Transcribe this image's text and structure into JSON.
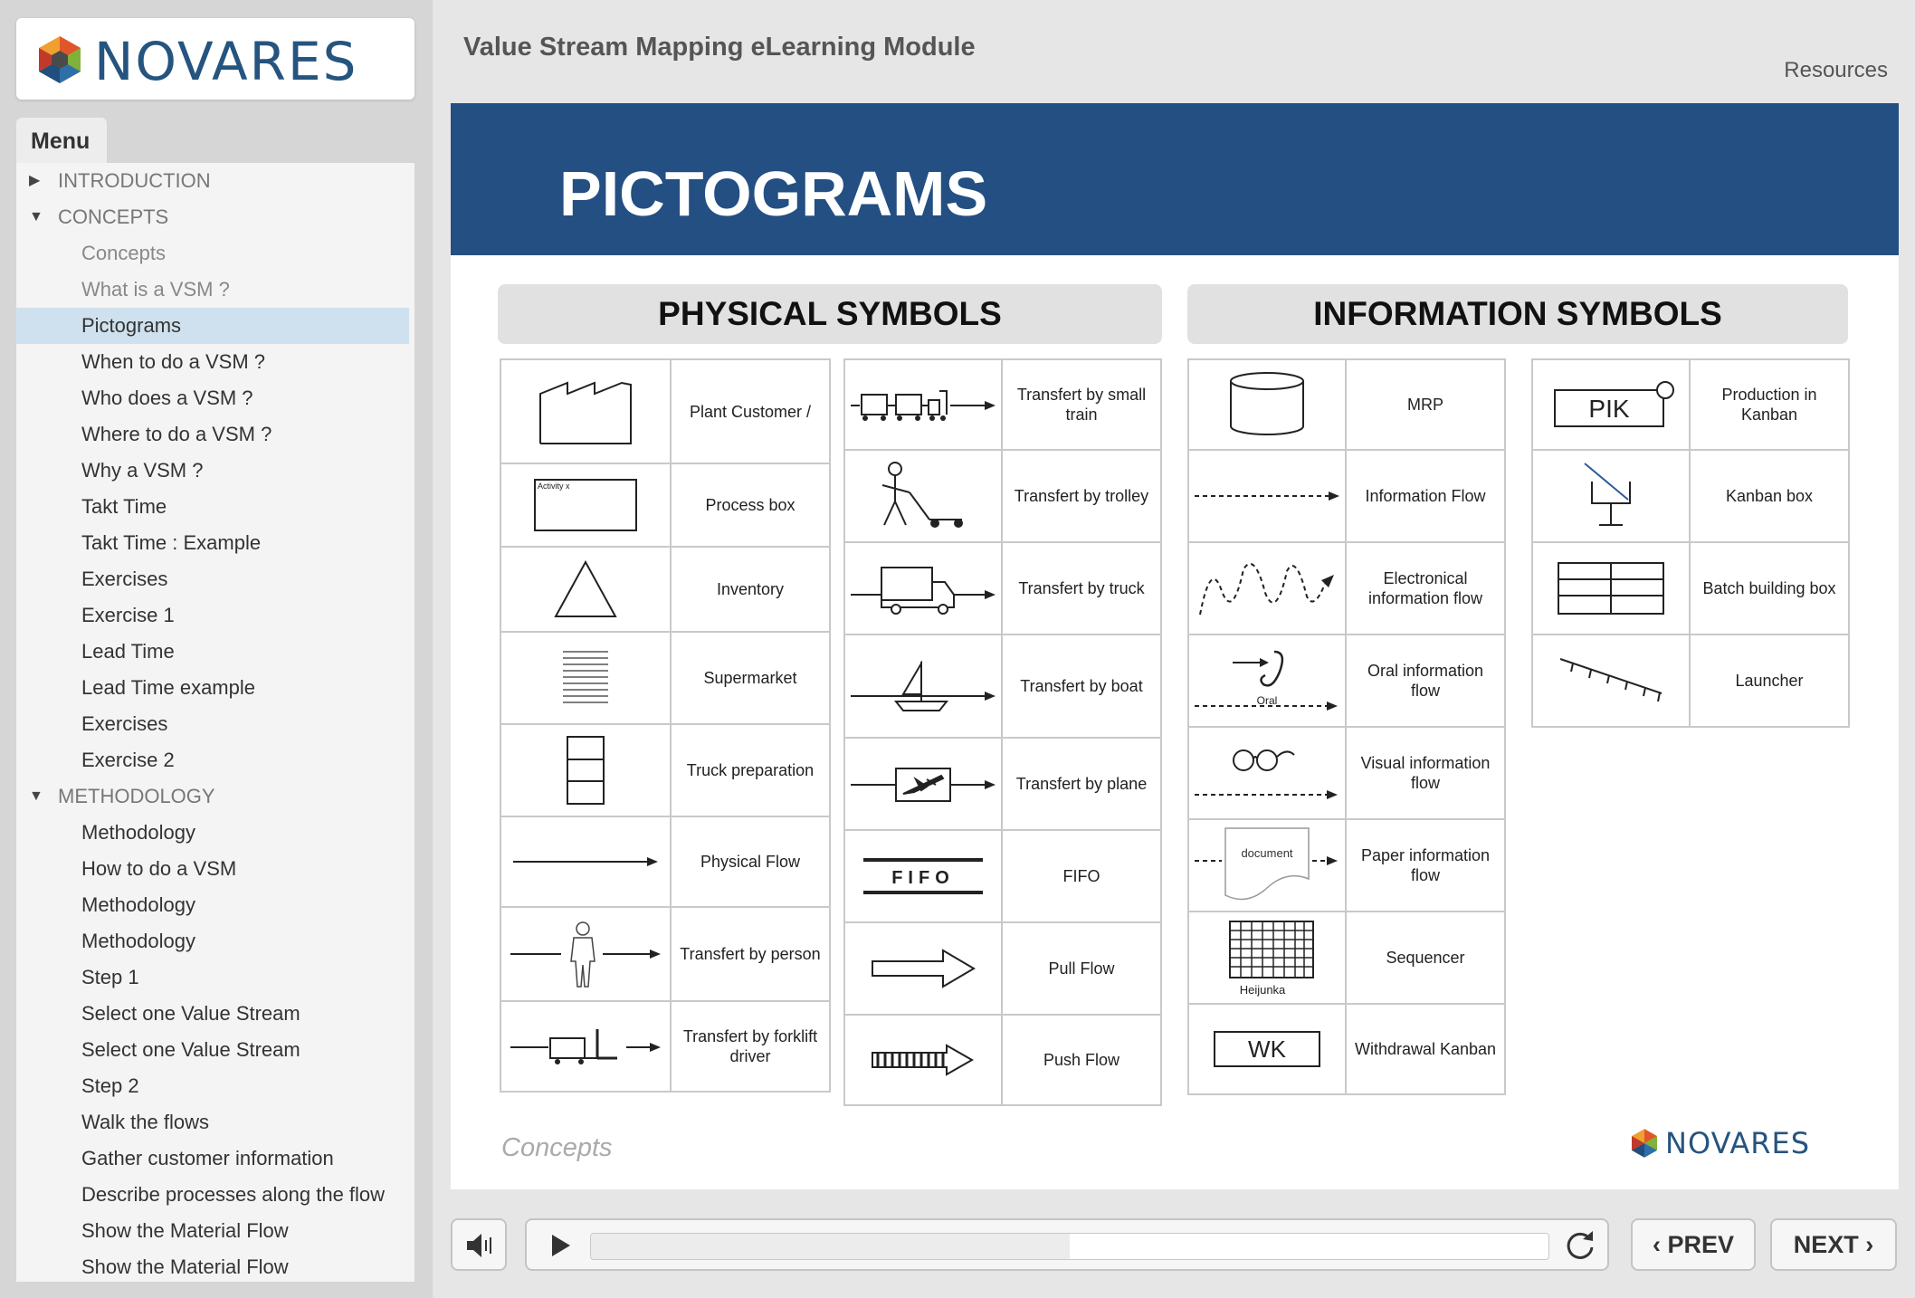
{
  "app": {
    "brand": "NOVARES",
    "module_title": "Value Stream Mapping eLearning Module",
    "resources_label": "Resources"
  },
  "menu": {
    "tab_label": "Menu",
    "rows": [
      {
        "type": "section",
        "label": "INTRODUCTION",
        "expanded": false
      },
      {
        "type": "section",
        "label": "CONCEPTS",
        "expanded": true
      },
      {
        "type": "item",
        "label": "Concepts",
        "visited": true
      },
      {
        "type": "item",
        "label": "What is a VSM ?",
        "visited": true
      },
      {
        "type": "item",
        "label": "Pictograms",
        "active": true
      },
      {
        "type": "item",
        "label": "When to do a VSM ?"
      },
      {
        "type": "item",
        "label": "Who does a VSM ?"
      },
      {
        "type": "item",
        "label": "Where to do a VSM ?"
      },
      {
        "type": "item",
        "label": "Why a VSM ?"
      },
      {
        "type": "item",
        "label": "Takt Time"
      },
      {
        "type": "item",
        "label": "Takt Time : Example"
      },
      {
        "type": "item",
        "label": "Exercises"
      },
      {
        "type": "item",
        "label": "Exercise 1"
      },
      {
        "type": "item",
        "label": "Lead Time"
      },
      {
        "type": "item",
        "label": "Lead Time example"
      },
      {
        "type": "item",
        "label": "Exercises"
      },
      {
        "type": "item",
        "label": "Exercise 2"
      },
      {
        "type": "section",
        "label": "METHODOLOGY",
        "expanded": true
      },
      {
        "type": "item",
        "label": "Methodology"
      },
      {
        "type": "item",
        "label": "How to do a VSM"
      },
      {
        "type": "item",
        "label": "Methodology"
      },
      {
        "type": "item",
        "label": "Methodology"
      },
      {
        "type": "item",
        "label": "Step 1"
      },
      {
        "type": "item",
        "label": "Select one Value Stream"
      },
      {
        "type": "item",
        "label": "Select one Value Stream"
      },
      {
        "type": "item",
        "label": "Step 2"
      },
      {
        "type": "item",
        "label": "Walk the flows"
      },
      {
        "type": "item",
        "label": "Gather customer information"
      },
      {
        "type": "item",
        "label": "Describe processes along the flow"
      },
      {
        "type": "item",
        "label": "Show the Material Flow"
      },
      {
        "type": "item",
        "label": "Show the Material Flow"
      }
    ]
  },
  "slide": {
    "title": "PICTOGRAMS",
    "footer_label": "Concepts",
    "physical": {
      "header": "PHYSICAL SYMBOLS",
      "col1": [
        {
          "label": "Plant Customer /",
          "icon": "factory-icon"
        },
        {
          "label": "Process box",
          "icon": "process-box-icon",
          "icon_text": "Activity x"
        },
        {
          "label": "Inventory",
          "icon": "inventory-triangle-icon"
        },
        {
          "label": "Supermarket",
          "icon": "supermarket-icon"
        },
        {
          "label": "Truck preparation",
          "icon": "truck-preparation-icon"
        },
        {
          "label": "Physical Flow",
          "icon": "physical-flow-arrow-icon"
        },
        {
          "label": "Transfert by person",
          "icon": "person-transfer-icon"
        },
        {
          "label": "Transfert by forklift driver",
          "icon": "forklift-icon"
        }
      ],
      "col2": [
        {
          "label": "Transfert by small train",
          "icon": "small-train-icon"
        },
        {
          "label": "Transfert by trolley",
          "icon": "trolley-icon"
        },
        {
          "label": "Transfert by truck",
          "icon": "truck-icon"
        },
        {
          "label": "Transfert by boat",
          "icon": "boat-icon"
        },
        {
          "label": "Transfert by plane",
          "icon": "plane-icon"
        },
        {
          "label": "FIFO",
          "icon": "fifo-icon",
          "icon_text": "FIFO"
        },
        {
          "label": "Pull Flow",
          "icon": "pull-flow-arrow-icon"
        },
        {
          "label": "Push Flow",
          "icon": "push-flow-arrow-icon"
        }
      ]
    },
    "information": {
      "header": "INFORMATION SYMBOLS",
      "col1": [
        {
          "label": "MRP",
          "icon": "mrp-cylinder-icon"
        },
        {
          "label": "Information Flow",
          "icon": "information-flow-arrow-icon"
        },
        {
          "label": "Electronical information flow",
          "icon": "electronic-flow-icon"
        },
        {
          "label": "Oral information flow",
          "icon": "oral-flow-icon",
          "icon_text": "Oral"
        },
        {
          "label": "Visual information flow",
          "icon": "visual-flow-icon"
        },
        {
          "label": "Paper information flow",
          "icon": "paper-flow-icon",
          "icon_text": "document"
        },
        {
          "label": "Sequencer",
          "icon": "heijunka-icon",
          "icon_text": "Heijunka"
        },
        {
          "label": "Withdrawal Kanban",
          "icon": "withdrawal-kanban-icon",
          "icon_text": "WK"
        }
      ],
      "col2": [
        {
          "label": "Production in Kanban",
          "icon": "pik-icon",
          "icon_text": "PIK"
        },
        {
          "label": "Kanban box",
          "icon": "kanban-box-icon"
        },
        {
          "label": "Batch building box",
          "icon": "batch-box-icon"
        },
        {
          "label": "Launcher",
          "icon": "launcher-icon"
        }
      ]
    }
  },
  "player": {
    "progress": 0.5,
    "prev_label": "PREV",
    "next_label": "NEXT"
  }
}
